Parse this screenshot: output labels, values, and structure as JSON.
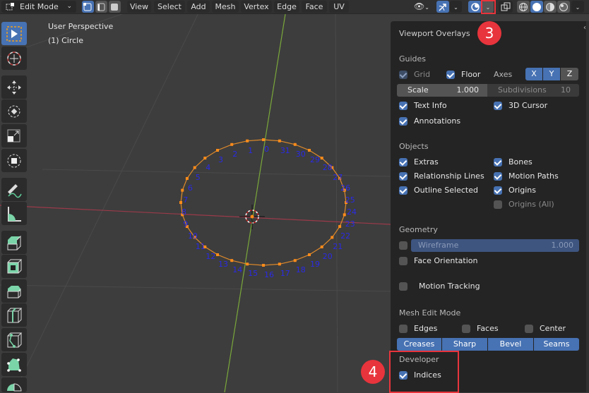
{
  "header": {
    "mode": "Edit Mode",
    "menus": [
      "View",
      "Select",
      "Add",
      "Mesh",
      "Vertex",
      "Edge",
      "Face",
      "UV"
    ],
    "select_modes": [
      "vertex-select",
      "edge-select",
      "face-select"
    ],
    "active_select_mode": "vertex-select"
  },
  "viewport": {
    "view_name": "User Perspective",
    "object_info": "(1) Circle",
    "vertex_indices": [
      "0",
      "1",
      "2",
      "3",
      "4",
      "5",
      "6",
      "7",
      "8",
      "9",
      "10",
      "11",
      "12",
      "13",
      "14",
      "15",
      "16",
      "17",
      "18",
      "19",
      "20",
      "21",
      "22",
      "23",
      "24",
      "25",
      "26",
      "27",
      "28",
      "29",
      "30",
      "31"
    ]
  },
  "toolbar": {
    "tools": [
      "select-box",
      "cursor",
      "move",
      "rotate",
      "scale",
      "transform",
      "annotate",
      "measure",
      "extrude-region",
      "inset-faces",
      "bevel",
      "loop-cut",
      "knife",
      "poly-build",
      "spin"
    ],
    "active_tool": "select-box"
  },
  "overlays": {
    "title": "Viewport Overlays",
    "guides": {
      "heading": "Guides",
      "grid": {
        "label": "Grid",
        "checked": true
      },
      "floor": {
        "label": "Floor",
        "checked": true
      },
      "axes_label": "Axes",
      "axes": [
        {
          "label": "X",
          "on": true
        },
        {
          "label": "Y",
          "on": true
        },
        {
          "label": "Z",
          "on": false
        }
      ],
      "scale_label": "Scale",
      "scale_value": "1.000",
      "subdivisions_label": "Subdivisions",
      "subdivisions_value": "10",
      "text_info": {
        "label": "Text Info",
        "checked": true
      },
      "cursor_3d": {
        "label": "3D Cursor",
        "checked": true
      },
      "annotations": {
        "label": "Annotations",
        "checked": true
      }
    },
    "objects": {
      "heading": "Objects",
      "extras": {
        "label": "Extras",
        "checked": true
      },
      "bones": {
        "label": "Bones",
        "checked": true
      },
      "relationship_lines": {
        "label": "Relationship Lines",
        "checked": true
      },
      "motion_paths": {
        "label": "Motion Paths",
        "checked": true
      },
      "outline_selected": {
        "label": "Outline Selected",
        "checked": true
      },
      "origins": {
        "label": "Origins",
        "checked": true
      },
      "origins_all": {
        "label": "Origins (All)",
        "checked": false
      }
    },
    "geometry": {
      "heading": "Geometry",
      "wireframe_label": "Wireframe",
      "wireframe_value": "1.000",
      "wireframe_checked": false,
      "face_orientation": {
        "label": "Face Orientation",
        "checked": false
      },
      "motion_tracking": {
        "label": "Motion Tracking",
        "checked": false
      }
    },
    "mesh_edit_mode": {
      "heading": "Mesh Edit Mode",
      "edges": {
        "label": "Edges",
        "checked": false
      },
      "faces": {
        "label": "Faces",
        "checked": false
      },
      "center": {
        "label": "Center",
        "checked": false
      },
      "buttons": [
        "Creases",
        "Sharp",
        "Bevel",
        "Seams"
      ]
    },
    "developer": {
      "heading": "Developer",
      "indices": {
        "label": "Indices",
        "checked": true
      }
    }
  },
  "annotations": {
    "step3": "3",
    "step4": "4",
    "highlight_color": "#e8343c"
  },
  "colors": {
    "accent": "#4772b3",
    "vertex": "#ff8c1a",
    "index_text": "#2a2ae6"
  }
}
